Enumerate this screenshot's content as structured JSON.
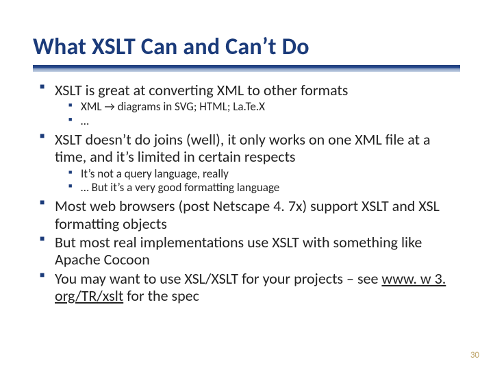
{
  "title": "What XSLT Can and Can’t Do",
  "bullets": {
    "b1": {
      "text": "XSLT is great at converting XML to other formats",
      "sub": {
        "s1": "XML → diagrams in SVG; HTML; La.Te.X",
        "s2": "…"
      }
    },
    "b2": {
      "text": "XSLT doesn’t do joins (well), it only works on one XML file at a time, and it’s limited in certain respects",
      "sub": {
        "s1": "It’s not a query language, really",
        "s2": "… But it’s a very good formatting language"
      }
    },
    "b3": {
      "text": "Most web browsers (post Netscape 4. 7x) support XSLT and XSL formatting objects"
    },
    "b4": {
      "text": "But most real implementations use XSLT with something like Apache Cocoon"
    },
    "b5": {
      "prefix": "You may want to use XSL/XSLT for your projects – see ",
      "link": "www. w 3. org/TR/xslt",
      "suffix": " for the spec"
    }
  },
  "page_number": "30"
}
